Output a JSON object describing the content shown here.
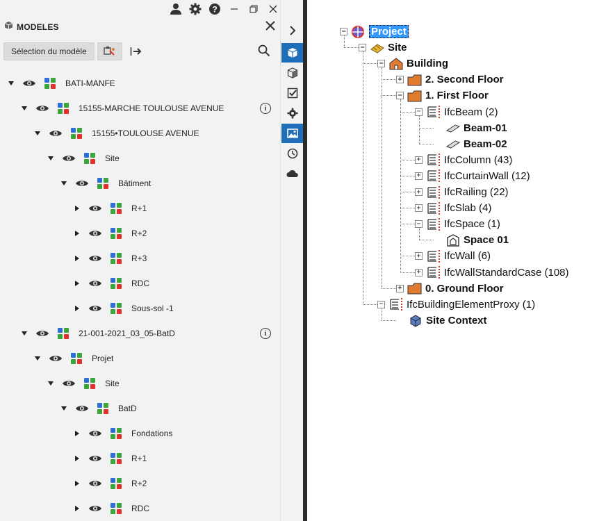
{
  "panel": {
    "title": "MODELES",
    "select_model_label": "Sélection du modèle"
  },
  "tree_rows": [
    {
      "label": "BATI-MANFE",
      "indent": 0,
      "expanded": true,
      "info": false
    },
    {
      "label": "15155-MARCHE TOULOUSE AVENUE",
      "indent": 1,
      "expanded": true,
      "info": true
    },
    {
      "label": "15155•TOULOUSE AVENUE",
      "indent": 2,
      "expanded": true,
      "info": false
    },
    {
      "label": "Site",
      "indent": 3,
      "expanded": true,
      "info": false
    },
    {
      "label": "Bâtiment",
      "indent": 4,
      "expanded": true,
      "info": false
    },
    {
      "label": "R+1",
      "indent": 5,
      "expanded": false,
      "info": false
    },
    {
      "label": "R+2",
      "indent": 5,
      "expanded": false,
      "info": false
    },
    {
      "label": "R+3",
      "indent": 5,
      "expanded": false,
      "info": false
    },
    {
      "label": "RDC",
      "indent": 5,
      "expanded": false,
      "info": false
    },
    {
      "label": "Sous-sol -1",
      "indent": 5,
      "expanded": false,
      "info": false
    },
    {
      "label": "21-001-2021_03_05-BatD",
      "indent": 1,
      "expanded": true,
      "info": true
    },
    {
      "label": "Projet",
      "indent": 2,
      "expanded": true,
      "info": false
    },
    {
      "label": "Site",
      "indent": 3,
      "expanded": true,
      "info": false
    },
    {
      "label": "BatD",
      "indent": 4,
      "expanded": true,
      "info": false
    },
    {
      "label": "Fondations",
      "indent": 5,
      "expanded": false,
      "info": false
    },
    {
      "label": "R+1",
      "indent": 5,
      "expanded": false,
      "info": false
    },
    {
      "label": "R+2",
      "indent": 5,
      "expanded": false,
      "info": false
    },
    {
      "label": "RDC",
      "indent": 5,
      "expanded": false,
      "info": false
    }
  ],
  "ifc_tree": [
    {
      "label": "Project",
      "pm": "−",
      "icon": "project-icon",
      "bold": true,
      "selected": true
    },
    {
      "label": "Site",
      "pm": "−",
      "icon": "site-icon",
      "bold": true
    },
    {
      "label": "Building",
      "pm": "−",
      "icon": "building-icon",
      "bold": true
    },
    {
      "label": "2. Second Floor",
      "pm": "+",
      "icon": "storey-icon",
      "bold": true
    },
    {
      "label": "1. First Floor",
      "pm": "−",
      "icon": "storey-icon",
      "bold": true
    },
    {
      "label": "IfcBeam (2)",
      "pm": "−",
      "icon": "ifc-type-icon",
      "bold": false
    },
    {
      "label": "Beam-01",
      "pm": "",
      "icon": "beam-icon",
      "bold": true
    },
    {
      "label": "Beam-02",
      "pm": "",
      "icon": "beam-icon",
      "bold": true
    },
    {
      "label": "IfcColumn (43)",
      "pm": "+",
      "icon": "ifc-type-icon",
      "bold": false
    },
    {
      "label": "IfcCurtainWall (12)",
      "pm": "+",
      "icon": "ifc-type-icon",
      "bold": false
    },
    {
      "label": "IfcRailing (22)",
      "pm": "+",
      "icon": "ifc-type-icon",
      "bold": false
    },
    {
      "label": "IfcSlab (4)",
      "pm": "+",
      "icon": "ifc-type-icon",
      "bold": false
    },
    {
      "label": "IfcSpace (1)",
      "pm": "−",
      "icon": "ifc-type-icon",
      "bold": false
    },
    {
      "label": "Space 01",
      "pm": "",
      "icon": "space-icon",
      "bold": true
    },
    {
      "label": "IfcWall (6)",
      "pm": "+",
      "icon": "ifc-type-icon",
      "bold": false
    },
    {
      "label": "IfcWallStandardCase (108)",
      "pm": "+",
      "icon": "ifc-type-icon",
      "bold": false
    },
    {
      "label": "0. Ground Floor",
      "pm": "+",
      "icon": "storey-icon",
      "bold": true
    },
    {
      "label": "IfcBuildingElementProxy (1)",
      "pm": "−",
      "icon": "ifc-type-icon",
      "bold": false
    },
    {
      "label": "Site Context",
      "pm": "",
      "icon": "context-icon",
      "bold": true
    }
  ],
  "colors": {
    "accent": "#1e6fb8",
    "cube_red": "#e2312d",
    "cube_green": "#3aa63a",
    "cube_blue": "#2d6fd6",
    "storey_orange": "#e07b30",
    "selection": "#3399ff"
  }
}
